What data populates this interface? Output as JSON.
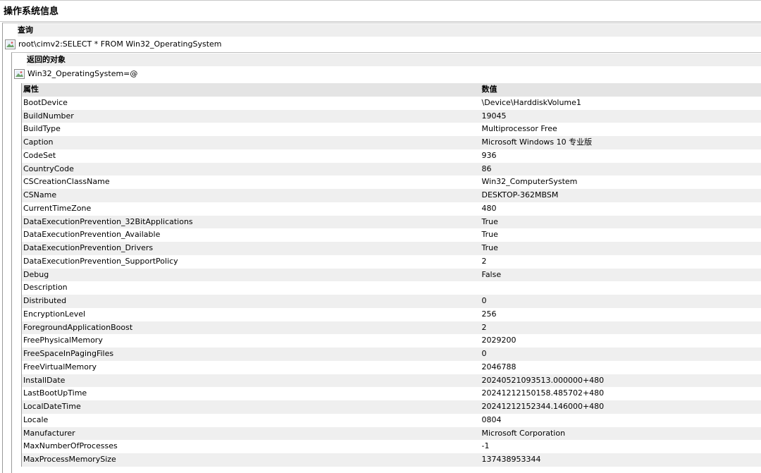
{
  "page_title": "操作系统信息",
  "query": {
    "header": "查询",
    "text": "root\\cimv2:SELECT * FROM Win32_OperatingSystem"
  },
  "returned": {
    "header": "返回的对象",
    "object": "Win32_OperatingSystem=@"
  },
  "table": {
    "col_property": "属性",
    "col_value": "数值",
    "rows": [
      {
        "p": "BootDevice",
        "v": "\\Device\\HarddiskVolume1"
      },
      {
        "p": "BuildNumber",
        "v": "19045"
      },
      {
        "p": "BuildType",
        "v": "Multiprocessor Free"
      },
      {
        "p": "Caption",
        "v": "Microsoft Windows 10 专业版"
      },
      {
        "p": "CodeSet",
        "v": "936"
      },
      {
        "p": "CountryCode",
        "v": "86"
      },
      {
        "p": "CSCreationClassName",
        "v": "Win32_ComputerSystem"
      },
      {
        "p": "CSName",
        "v": "DESKTOP-362MBSM"
      },
      {
        "p": "CurrentTimeZone",
        "v": "480"
      },
      {
        "p": "DataExecutionPrevention_32BitApplications",
        "v": "True"
      },
      {
        "p": "DataExecutionPrevention_Available",
        "v": "True"
      },
      {
        "p": "DataExecutionPrevention_Drivers",
        "v": "True"
      },
      {
        "p": "DataExecutionPrevention_SupportPolicy",
        "v": "2"
      },
      {
        "p": "Debug",
        "v": "False"
      },
      {
        "p": "Description",
        "v": ""
      },
      {
        "p": "Distributed",
        "v": "0"
      },
      {
        "p": "EncryptionLevel",
        "v": "256"
      },
      {
        "p": "ForegroundApplicationBoost",
        "v": "2"
      },
      {
        "p": "FreePhysicalMemory",
        "v": "2029200"
      },
      {
        "p": "FreeSpaceInPagingFiles",
        "v": "0"
      },
      {
        "p": "FreeVirtualMemory",
        "v": "2046788"
      },
      {
        "p": "InstallDate",
        "v": "20240521093513.000000+480"
      },
      {
        "p": "LastBootUpTime",
        "v": "20241212150158.485702+480"
      },
      {
        "p": "LocalDateTime",
        "v": "20241212152344.146000+480"
      },
      {
        "p": "Locale",
        "v": "0804"
      },
      {
        "p": "Manufacturer",
        "v": "Microsoft Corporation"
      },
      {
        "p": "MaxNumberOfProcesses",
        "v": "-1"
      },
      {
        "p": "MaxProcessMemorySize",
        "v": "137438953344"
      }
    ]
  }
}
